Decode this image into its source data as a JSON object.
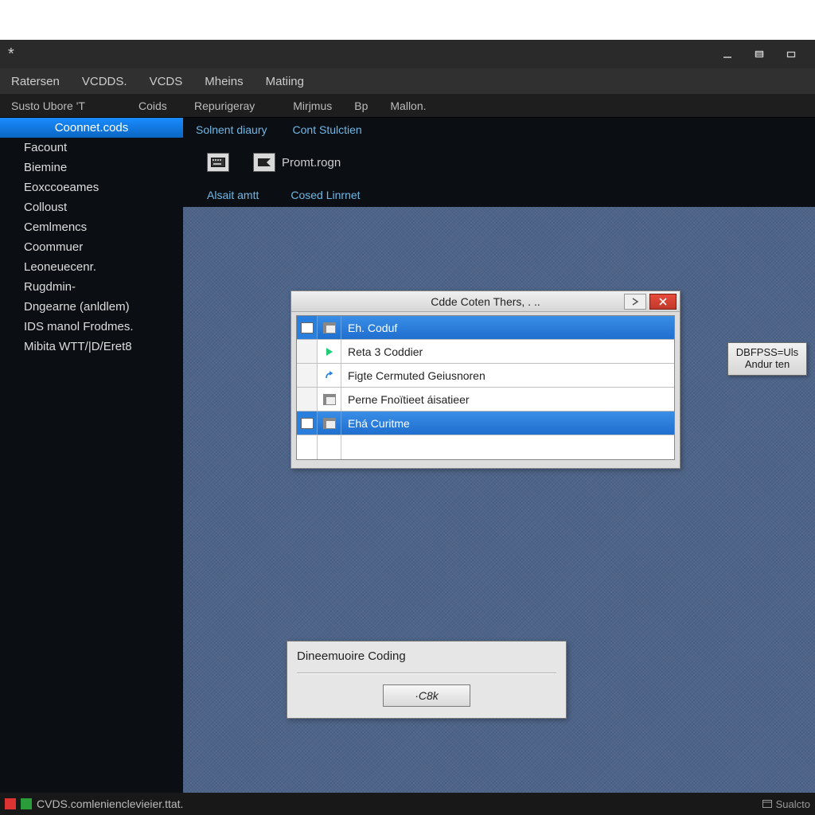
{
  "titlebar": {
    "marker": "*"
  },
  "menubar": {
    "items": [
      "Ratersen",
      "VCDDS.",
      "VCDS",
      "Mheins",
      "Matiing"
    ]
  },
  "secbar": {
    "items": [
      "Susto Ubore 'T",
      "Coids",
      "Repurigeray",
      "Mirjmus",
      "Bp",
      "Mallon."
    ]
  },
  "sidebar": {
    "top": "Coonnet.cods",
    "items": [
      "Facount",
      "Biemine",
      "Eoxccoeames",
      "Colloust",
      "Cemlmencs",
      "Coommuer",
      "Leoneuecenr.",
      "Rugdmin-",
      "Dngearne   (anldlem)",
      "IDS manol Frodmes.",
      "Mibita WTT/|D/Eret8"
    ]
  },
  "subtab": {
    "tabs": [
      "Solnent diaury",
      "Cont Stulctien"
    ]
  },
  "iconrow": {
    "label2": "Promt.rogn"
  },
  "linkrow": {
    "a": "Alsait amtt",
    "b": "Cosed Linrnet"
  },
  "dialog": {
    "title": "Cdde Coten Thers, . ..",
    "rows": [
      {
        "label": "Eh. Coduf",
        "selected": true
      },
      {
        "label": "Reta 3 Coddier",
        "selected": false
      },
      {
        "label": "Figte Cermuted Geiusnoren",
        "selected": false
      },
      {
        "label": "Perne Fnoïtieet áisatieer",
        "selected": false
      },
      {
        "label": "Ehá Curitme",
        "selected": true
      }
    ]
  },
  "okdlg": {
    "label": "Dineemuoire Coding",
    "ok": "·C8k"
  },
  "rbtn": {
    "line1": "DBFPSS=Uls",
    "line2": "Andur ten"
  },
  "statusbar": {
    "text": "CVDS.comlenienclevieier.ttat.",
    "right": "Sualcto"
  }
}
